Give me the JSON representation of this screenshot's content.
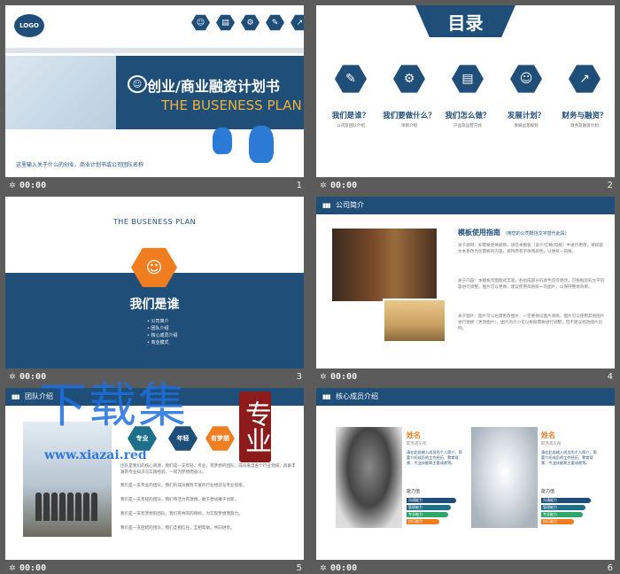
{
  "slides": [
    {
      "number": "1",
      "time": "00:00",
      "logo": "LOGO",
      "title": "创业/商业融资计划书",
      "subtitle": "THE BUSENESS PLAN",
      "description": "这里输入关于什么的创业、商业计划书或公司团队名称",
      "icons": [
        "people-icon",
        "chart-icon",
        "gear-icon",
        "pen-icon",
        "growth-icon"
      ]
    },
    {
      "number": "2",
      "time": "00:00",
      "title": "目录",
      "items": [
        {
          "label": "我们是谁？",
          "sub": "公司及团队介绍",
          "icon": "document-icon",
          "glyph": "✎"
        },
        {
          "label": "我们要做什么？",
          "sub": "项目介绍",
          "icon": "user-gear-icon",
          "glyph": "⚙"
        },
        {
          "label": "我们怎么做？",
          "sub": "产品及运营方式",
          "icon": "presentation-icon",
          "glyph": "▤"
        },
        {
          "label": "发展计划？",
          "sub": "发展远景规划",
          "icon": "team-icon",
          "glyph": "☺"
        },
        {
          "label": "财务与融资？",
          "sub": "财务及融资计划",
          "icon": "chart-growth-icon",
          "glyph": "↗"
        }
      ]
    },
    {
      "number": "3",
      "time": "00:00",
      "subtitle": "THE BUSENESS PLAN",
      "title": "我们是谁",
      "list": [
        "公司简介",
        "团队介绍",
        "核心成员介绍",
        "商业模式"
      ]
    },
    {
      "number": "4",
      "time": "00:00",
      "header": "公司简介",
      "heading": "模板使用指南",
      "heading_note": "（用您的公司概括文字替代此段）",
      "paragraphs": [
        "关于题目：如需要更换题目，请在本模板（设计/切换/母版）中进行更改，将标题文本更改为您需要的内容，保持原有字体和颜色，以便统一风格。",
        "关于内容：本模板页面版式丰富，各组成部分的颜色均可更改，可根据您的文字内容进行调整，图片可以更换，建议使用风格统一的图片，以保持整体效果。",
        "关于图片：图片可以右键更改图片，一定要保证图片清晰，图片可以使用其他图片进行替换（更改图片），图片的大小可以根据需要进行调整，但不建议修改图片比例。"
      ]
    },
    {
      "number": "5",
      "time": "00:00",
      "header": "团队介绍",
      "tags": [
        "专业",
        "年轻",
        "有梦想"
      ],
      "paragraphs": [
        "团队是我们的核心资源，我们是一支年轻、专业、有梦想的团队，成员来自各个行业领域，具备丰富的专业知识与实践经验，一同为梦想而奋斗。",
        "我们是一支专业的团队，我们的成员拥有丰富的行业经验与专业技能。",
        "我们是一支年轻的团队，我们有活力有激情，敢于尝试敢于创新。",
        "我们是一支有梦想的团队，我们有共同的目标，为实现梦想而努力。",
        "我们是一支团结的团队，我们互相信任，互相帮助，共同进步。"
      ]
    },
    {
      "number": "6",
      "time": "00:00",
      "header": "核心成员介绍",
      "members": [
        {
          "name": "姓名",
          "role": "职务或头衔",
          "desc": "请在此处输入成员的个人简介，简要介绍成员的工作经历、教育背景、专业技能和主要成就等。",
          "skill_label": "能力值",
          "skills": [
            {
              "label": "沟通能力",
              "value": 0.9
            },
            {
              "label": "管理能力",
              "value": 0.8
            },
            {
              "label": "专业能力",
              "value": 0.75
            },
            {
              "label": "执行能力",
              "value": 0.6
            }
          ]
        },
        {
          "name": "姓名",
          "role": "职务或头衔",
          "desc": "请在此处输入成员的个人简介，简要介绍成员的工作经历、教育背景、专业技能和主要成就等。",
          "skill_label": "能力值",
          "skills": [
            {
              "label": "沟通能力",
              "value": 0.9
            },
            {
              "label": "管理能力",
              "value": 0.8
            },
            {
              "label": "专业能力",
              "value": 0.75
            },
            {
              "label": "执行能力",
              "value": 0.6
            }
          ]
        }
      ]
    }
  ],
  "watermark": {
    "text": "下载集",
    "url": "www.xiazai.red",
    "stamp": "专业"
  },
  "colors": {
    "navy": "#1f4e79",
    "orange": "#f07d1f",
    "teal": "#1e6f8a",
    "green": "#2fa66a",
    "gray_bg": "#5b5b5b"
  }
}
